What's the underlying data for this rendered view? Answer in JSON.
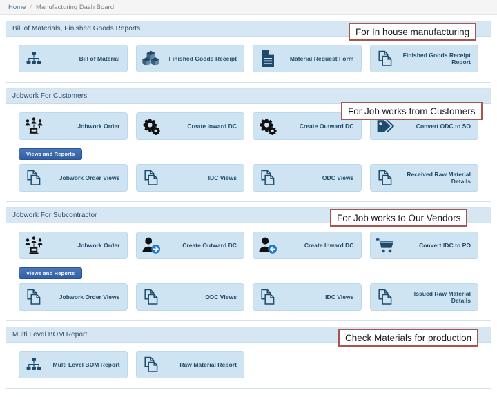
{
  "breadcrumb": {
    "home": "Home",
    "separator": "/",
    "current": "Manufacturing Dash Board"
  },
  "colors": {
    "panel_header_bg": "#d6e7f3",
    "card_bg": "#cfe4f2",
    "card_text": "#22496a",
    "badge_bg": "#2f5fa5",
    "annotation_border": "#a65550"
  },
  "sections": [
    {
      "id": "bom-finished-goods",
      "title": "Bill of Materials, Finished Goods Reports",
      "annotation": "For In house manufacturing",
      "cards": [
        {
          "label": "Bill of Material",
          "icon": "hierarchy-icon"
        },
        {
          "label": "Finished Goods Receipt",
          "icon": "boxes-icon"
        },
        {
          "label": "Material Request Form",
          "icon": "document-icon"
        },
        {
          "label": "Finished Goods Receipt Report",
          "icon": "copy-pages-icon"
        }
      ],
      "has_views_and_reports": false,
      "views_label": "",
      "views_cards": []
    },
    {
      "id": "jobwork-for-customers",
      "title": "Jobwork For Customers",
      "annotation": "For Job works from Customers",
      "cards": [
        {
          "label": "Jobwork Order",
          "icon": "team-workstation-icon"
        },
        {
          "label": "Create Inward DC",
          "icon": "gears-icon"
        },
        {
          "label": "Create Outward DC",
          "icon": "gears-icon"
        },
        {
          "label": "Convert ODC to SO",
          "icon": "tags-icon"
        }
      ],
      "has_views_and_reports": true,
      "views_label": "Views and Reports",
      "views_cards": [
        {
          "label": "Jobwork Order Views",
          "icon": "copy-pages-icon"
        },
        {
          "label": "IDC Views",
          "icon": "copy-pages-icon"
        },
        {
          "label": "ODC Views",
          "icon": "copy-pages-icon"
        },
        {
          "label": "Received Raw Material Details",
          "icon": "copy-pages-icon"
        }
      ]
    },
    {
      "id": "jobwork-for-subcontractor",
      "title": "Jobwork For Subcontractor",
      "annotation": "For Job works to Our Vendors",
      "cards": [
        {
          "label": "Jobwork Order",
          "icon": "team-workstation-icon"
        },
        {
          "label": "Create Outward DC",
          "icon": "user-arrow-right-icon"
        },
        {
          "label": "Create Inward DC",
          "icon": "user-arrow-left-icon"
        },
        {
          "label": "Convert IDC to PO",
          "icon": "shopping-cart-icon"
        }
      ],
      "has_views_and_reports": true,
      "views_label": "Views and Reports",
      "views_cards": [
        {
          "label": "Jobwork Order Views",
          "icon": "copy-pages-icon"
        },
        {
          "label": "ODC Views",
          "icon": "copy-pages-icon"
        },
        {
          "label": "IDC Views",
          "icon": "copy-pages-icon"
        },
        {
          "label": "Issued Raw Material Details",
          "icon": "copy-pages-icon"
        }
      ]
    },
    {
      "id": "multi-level-bom-report",
      "title": "Multi Level BOM Report",
      "annotation": "Check Materials for production",
      "cards": [
        {
          "label": "Multi Level BOM Report",
          "icon": "hierarchy-icon"
        },
        {
          "label": "Raw Material Report",
          "icon": "copy-pages-icon"
        }
      ],
      "has_views_and_reports": false,
      "views_label": "",
      "views_cards": []
    }
  ]
}
